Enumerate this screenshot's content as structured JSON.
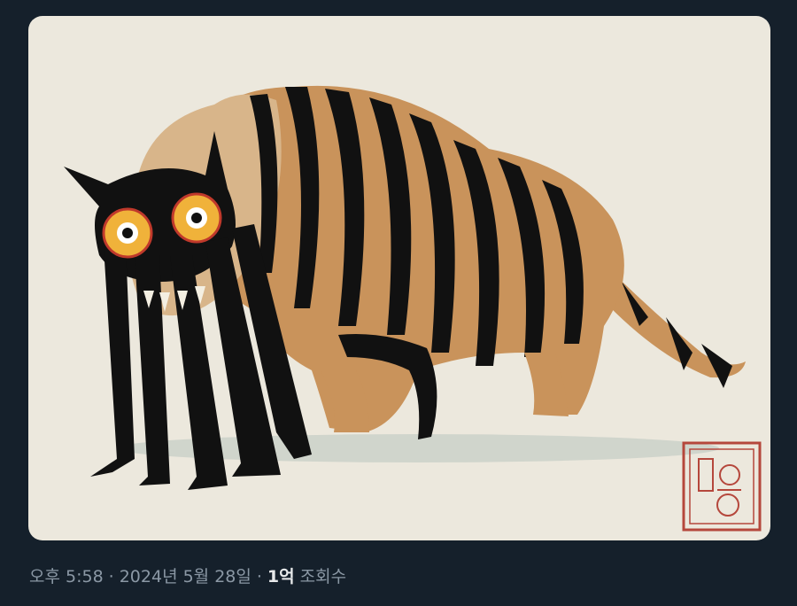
{
  "tweet": {
    "time": "오후 5:58",
    "separator": "·",
    "date": "2024년 5월 28일",
    "views_count": "1억",
    "views_label": "조회수"
  },
  "media": {
    "icon": "tiger-cat-illustration",
    "stamp_icon": "red-seal-stamp",
    "colors": {
      "background": "#15202b",
      "card": "#ece8dd",
      "fur": "#c9935b",
      "stripes": "#111111",
      "eyes": "#f0b23a",
      "stamp": "#b5473c",
      "meta_text": "#8b98a5",
      "meta_bold": "#e7e9ea"
    }
  }
}
